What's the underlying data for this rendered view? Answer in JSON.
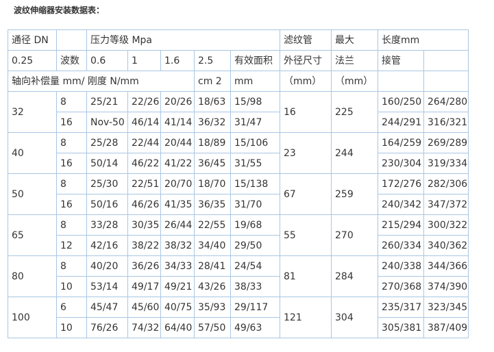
{
  "title": "波纹伸缩器安装数据表：",
  "header": {
    "row1": {
      "dn_label": "通径 DN",
      "pressure_label": "压力等级 Mpa",
      "filter_pipe": "滤纹管",
      "max": "最大",
      "length": "长度mm"
    },
    "row2": {
      "first": "0.25",
      "waves": "波数",
      "p06": "0.6",
      "p1": "1",
      "p16": "1.6",
      "p25": "2.5",
      "effective_area": "有效面积",
      "outer_size": "外径尺寸",
      "flange": "法兰",
      "pipe": "接管"
    },
    "row3": {
      "comp_stiff": "轴向补偿量 mm/ 刚度 N/mm",
      "cm2": "cm 2",
      "mm": "mm",
      "outer_unit": "（mm）",
      "flange_unit": "（mm）"
    }
  },
  "groups": [
    {
      "dn": "32",
      "outer": "16",
      "max": "225",
      "rows": [
        {
          "waves": "8",
          "p06": "25/21",
          "p1": "22/26",
          "p16": "20/26",
          "p25": "18/63",
          "area": "15/98",
          "flange": "160/250",
          "pipe": "264/280"
        },
        {
          "waves": "16",
          "p06": "Nov-50",
          "p1": "46/14",
          "p16": "41/14",
          "p25": "36/32",
          "area": "31/47",
          "flange": "244/291",
          "pipe": "316/321"
        }
      ]
    },
    {
      "dn": "40",
      "outer": "23",
      "max": "244",
      "rows": [
        {
          "waves": "8",
          "p06": "25/28",
          "p1": "22/44",
          "p16": "20/44",
          "p25": "18/89",
          "area": "15/106",
          "flange": "164/259",
          "pipe": "269/289"
        },
        {
          "waves": "16",
          "p06": "50/14",
          "p1": "46/22",
          "p16": "41/22",
          "p25": "36/45",
          "area": "31/55",
          "flange": "230/304",
          "pipe": "319/334"
        }
      ]
    },
    {
      "dn": "50",
      "outer": "67",
      "max": "259",
      "rows": [
        {
          "waves": "8",
          "p06": "25/30",
          "p1": "22/51",
          "p16": "20/70",
          "p25": "18/70",
          "area": "15/138",
          "flange": "172/276",
          "pipe": "282/306"
        },
        {
          "waves": "16",
          "p06": "50/16",
          "p1": "46/26",
          "p16": "41/35",
          "p25": "36/35",
          "area": "31/70",
          "flange": "240/342",
          "pipe": "347/372"
        }
      ]
    },
    {
      "dn": "65",
      "outer": "55",
      "max": "270",
      "rows": [
        {
          "waves": "8",
          "p06": "33/28",
          "p1": "30/35",
          "p16": "26/44",
          "p25": "22/55",
          "area": "19/68",
          "flange": "215/294",
          "pipe": "300/322"
        },
        {
          "waves": "12",
          "p06": "42/16",
          "p1": "38/22",
          "p16": "38/32",
          "p25": "34/40",
          "area": "29/50",
          "flange": "260/334",
          "pipe": "340/362"
        }
      ]
    },
    {
      "dn": "80",
      "outer": "81",
      "max": "284",
      "rows": [
        {
          "waves": "8",
          "p06": "40/20",
          "p1": "36/26",
          "p16": "34/33",
          "p25": "28/41",
          "area": "24/54",
          "flange": "240/338",
          "pipe": "344/366"
        },
        {
          "waves": "10",
          "p06": "53/14",
          "p1": "49/17",
          "p16": "49/21",
          "p25": "43/26",
          "area": "38/33",
          "flange": "270/368",
          "pipe": "374/390"
        }
      ]
    },
    {
      "dn": "100",
      "outer": "121",
      "max": "304",
      "rows": [
        {
          "waves": "6",
          "p06": "45/47",
          "p1": "45/60",
          "p16": "40/75",
          "p25": "35/93",
          "area": "29/117",
          "flange": "235/317",
          "pipe": "323/345"
        },
        {
          "waves": "10",
          "p06": "76/26",
          "p1": "74/32",
          "p16": "64/40",
          "p25": "57/50",
          "area": "49/63",
          "flange": "305/381",
          "pipe": "387/409"
        }
      ]
    }
  ]
}
